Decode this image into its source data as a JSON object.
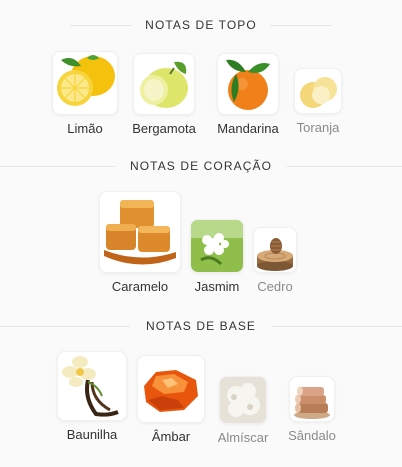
{
  "sections": [
    {
      "title": "NOTAS DE TOPO",
      "notes": [
        {
          "label": "Limão",
          "icon": "lemon-icon",
          "dim": false
        },
        {
          "label": "Bergamota",
          "icon": "bergamot-icon",
          "dim": false
        },
        {
          "label": "Mandarina",
          "icon": "mandarin-icon",
          "dim": false
        },
        {
          "label": "Toranja",
          "icon": "grapefruit-icon",
          "dim": true
        }
      ]
    },
    {
      "title": "NOTAS DE CORAÇÃO",
      "notes": [
        {
          "label": "Caramelo",
          "icon": "caramel-icon",
          "dim": false
        },
        {
          "label": "Jasmim",
          "icon": "jasmine-icon",
          "dim": false
        },
        {
          "label": "Cedro",
          "icon": "cedar-icon",
          "dim": true
        }
      ]
    },
    {
      "title": "NOTAS DE BASE",
      "notes": [
        {
          "label": "Baunilha",
          "icon": "vanilla-icon",
          "dim": false
        },
        {
          "label": "Âmbar",
          "icon": "amber-icon",
          "dim": false
        },
        {
          "label": "Almíscar",
          "icon": "musk-icon",
          "dim": true
        },
        {
          "label": "Sândalo",
          "icon": "sandalwood-icon",
          "dim": true
        }
      ]
    }
  ]
}
